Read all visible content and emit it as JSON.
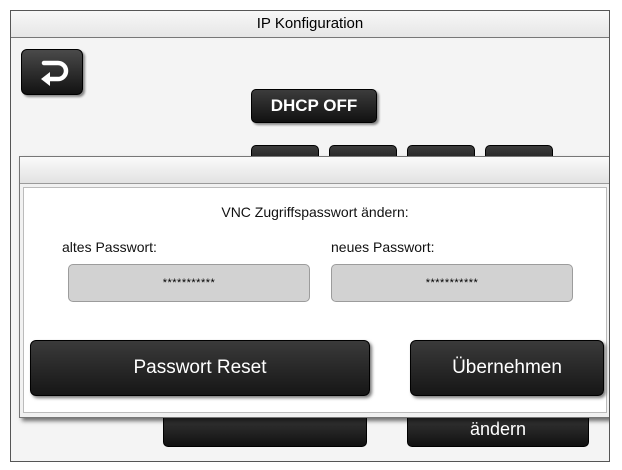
{
  "window": {
    "title": "IP Konfiguration"
  },
  "background": {
    "dhcp_button": "DHCP OFF",
    "bottom_right_button": "ändern",
    "back_icon": "back-arrow-icon"
  },
  "dialog": {
    "title": "VNC Zugriffspasswort ändern:",
    "old_password_label": "altes Passwort:",
    "old_password_value": "***********",
    "new_password_label": "neues Passwort:",
    "new_password_value": "***********",
    "reset_button": "Passwort Reset",
    "apply_button": "Übernehmen"
  }
}
